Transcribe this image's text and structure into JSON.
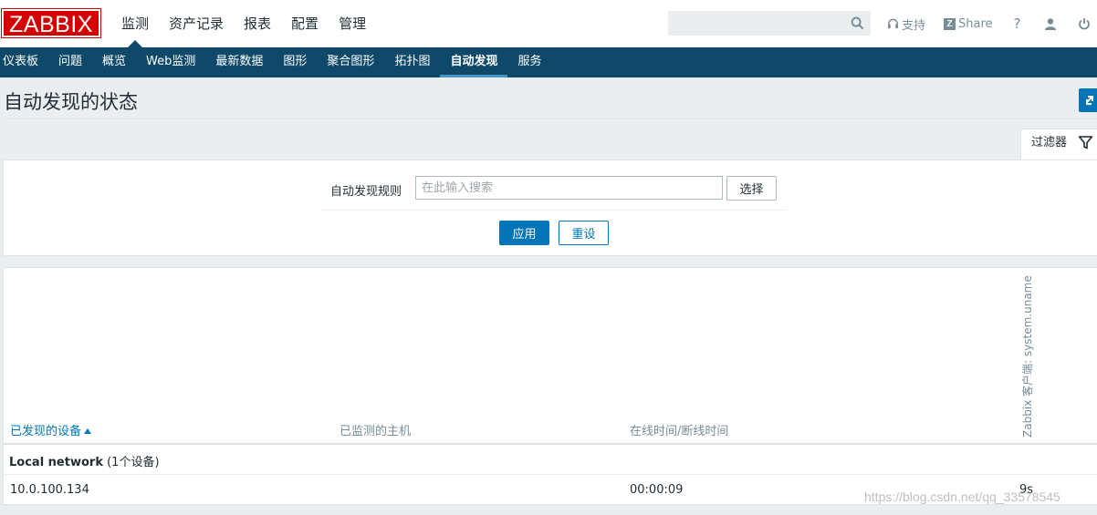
{
  "header": {
    "logo": "ZABBIX",
    "main_menu": [
      {
        "label": "监测",
        "active": true
      },
      {
        "label": "资产记录",
        "active": false
      },
      {
        "label": "报表",
        "active": false
      },
      {
        "label": "配置",
        "active": false
      },
      {
        "label": "管理",
        "active": false
      }
    ],
    "search": {
      "value": "",
      "placeholder": ""
    },
    "support_label": "支持",
    "share_label": "Share",
    "share_badge": "Z",
    "help_label": "?"
  },
  "submenu": [
    {
      "label": "仪表板",
      "active": false
    },
    {
      "label": "问题",
      "active": false
    },
    {
      "label": "概览",
      "active": false
    },
    {
      "label": "Web监测",
      "active": false
    },
    {
      "label": "最新数据",
      "active": false
    },
    {
      "label": "图形",
      "active": false
    },
    {
      "label": "聚合图形",
      "active": false
    },
    {
      "label": "拓扑图",
      "active": false
    },
    {
      "label": "自动发现",
      "active": true
    },
    {
      "label": "服务",
      "active": false
    }
  ],
  "page": {
    "title": "自动发现的状态"
  },
  "filter": {
    "tab_label": "过滤器",
    "rule_label": "自动发现规则",
    "rule_value": "",
    "rule_placeholder": "在此输入搜索",
    "select_label": "选择",
    "apply_label": "应用",
    "reset_label": "重设"
  },
  "table": {
    "columns": {
      "device": "已发现的设备",
      "monitored_host": "已监测的主机",
      "uptime": "在线时间/断线时间",
      "check": "Zabbix 客户端: system.uname"
    },
    "group": {
      "name": "Local network",
      "count_text": "(1个设备)"
    },
    "rows": [
      {
        "device": "10.0.100.134",
        "monitored_host": "",
        "uptime": "00:00:09",
        "check": "9s"
      }
    ]
  },
  "watermark": "https://blog.csdn.net/qq_33578545",
  "colors": {
    "brand_red": "#d40000",
    "nav_blue": "#0e4969",
    "accent_blue": "#0275b8",
    "page_bg": "#ebeef0"
  }
}
